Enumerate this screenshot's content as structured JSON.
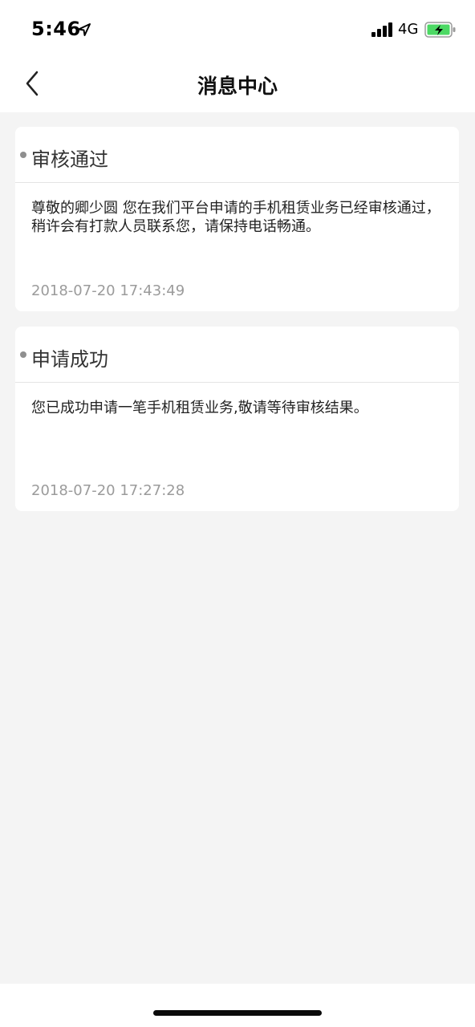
{
  "status_bar": {
    "time": "5:46",
    "network": "4G",
    "location_icon": "location-arrow-icon",
    "signal_icon": "signal-bars-icon",
    "battery_icon": "battery-charging-icon",
    "battery_color": "#4cd964"
  },
  "nav": {
    "title": "消息中心",
    "back_icon": "chevron-left-icon"
  },
  "messages": [
    {
      "title": "审核通过",
      "body": "尊敬的卿少圆 您在我们平台申请的手机租赁业务已经审核通过，稍许会有打款人员联系您，请保持电话畅通。",
      "timestamp": "2018-07-20 17:43:49"
    },
    {
      "title": "申请成功",
      "body": "您已成功申请一笔手机租赁业务,敬请等待审核结果。",
      "timestamp": "2018-07-20 17:27:28"
    }
  ]
}
